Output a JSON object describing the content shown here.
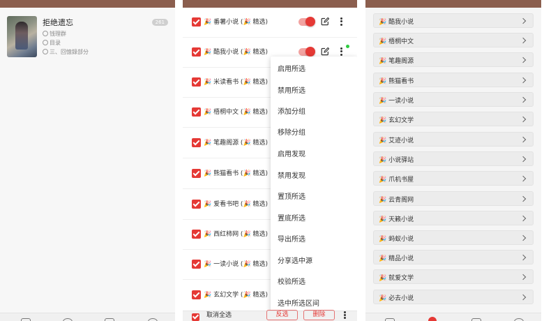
{
  "book": {
    "title": "拒绝遗忘",
    "badge": "261",
    "author": "钱理群",
    "toc": "目录",
    "chapter": "三、回憶錄部分"
  },
  "sources": [
    {
      "name": "🎉 番薯小说 (🎉 精选)"
    },
    {
      "name": "🎉 酷我小说 (🎉 精选)"
    },
    {
      "name": "🎉 米读看书 (🎉 精选)"
    },
    {
      "name": "🎉 梧桐中文 (🎉 精选)"
    },
    {
      "name": "🎉 笔趣阁源 (🎉 精选)"
    },
    {
      "name": "🎉 熊猫看书 (🎉 精选)"
    },
    {
      "name": "🎉 爱看书吧 (🎉 精选)"
    },
    {
      "name": "🎉 西红柿网 (🎉 精选)"
    },
    {
      "name": "🎉 一读小说 (🎉 精选)"
    },
    {
      "name": "🎉 玄幻文学 (🎉 精选)"
    }
  ],
  "menu": [
    "启用所选",
    "禁用所选",
    "添加分组",
    "移除分组",
    "启用发现",
    "禁用发现",
    "置顶所选",
    "置底所选",
    "导出所选",
    "分享选中源",
    "校验所选",
    "选中所选区间"
  ],
  "bottom": {
    "deselect_all": "取消全选",
    "invert": "反选",
    "delete": "删除"
  },
  "list": [
    "🎉 酷我小说",
    "🎉 梧桐中文",
    "🎉 笔趣阁源",
    "🎉 熊猫看书",
    "🎉 一读小说",
    "🎉 玄幻文学",
    "🎉 艾迹小说",
    "🎉 小说驿站",
    "🎉 爪机书屋",
    "🎉 云青阁网",
    "🎉 天籁小说",
    "🎉 蚂蚁小说",
    "🎉 精品小说",
    "🎉 就爱文学",
    "🎉 必去小说"
  ],
  "colors": {
    "accent": "#e53935",
    "topbar": "#8b5e4e",
    "toggle_track": "#f2a3a1"
  }
}
